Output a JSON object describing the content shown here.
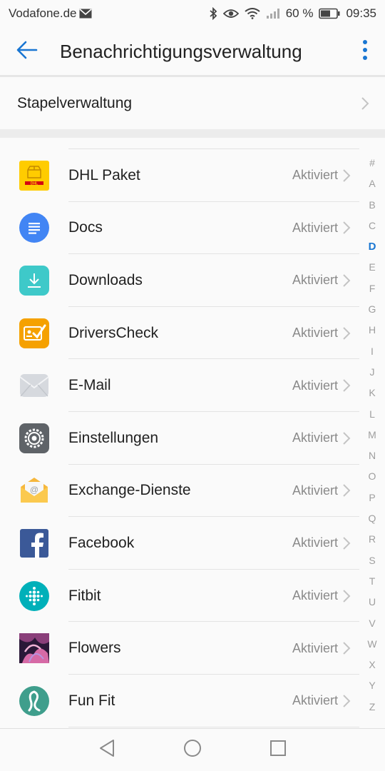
{
  "status_bar": {
    "carrier": "Vodafone.de",
    "battery_percent": "60 %",
    "time": "09:35",
    "icons": [
      "mail-icon",
      "bluetooth-icon",
      "eye-icon",
      "wifi-icon",
      "signal-icon",
      "battery-icon"
    ]
  },
  "header": {
    "title": "Benachrichtigungsverwaltung"
  },
  "stack": {
    "label": "Stapelverwaltung"
  },
  "apps": [
    {
      "name": "DHL Paket",
      "status": "Aktiviert",
      "icon": "dhl-icon"
    },
    {
      "name": "Docs",
      "status": "Aktiviert",
      "icon": "docs-icon"
    },
    {
      "name": "Downloads",
      "status": "Aktiviert",
      "icon": "downloads-icon"
    },
    {
      "name": "DriversCheck",
      "status": "Aktiviert",
      "icon": "driverscheck-icon"
    },
    {
      "name": "E-Mail",
      "status": "Aktiviert",
      "icon": "email-icon"
    },
    {
      "name": "Einstellungen",
      "status": "Aktiviert",
      "icon": "settings-icon"
    },
    {
      "name": "Exchange-Dienste",
      "status": "Aktiviert",
      "icon": "exchange-icon"
    },
    {
      "name": "Facebook",
      "status": "Aktiviert",
      "icon": "facebook-icon"
    },
    {
      "name": "Fitbit",
      "status": "Aktiviert",
      "icon": "fitbit-icon"
    },
    {
      "name": "Flowers",
      "status": "Aktiviert",
      "icon": "flowers-icon"
    },
    {
      "name": "Fun Fit",
      "status": "Aktiviert",
      "icon": "funfit-icon"
    }
  ],
  "index": {
    "letters": [
      "#",
      "A",
      "B",
      "C",
      "D",
      "E",
      "F",
      "G",
      "H",
      "I",
      "J",
      "K",
      "L",
      "M",
      "N",
      "O",
      "P",
      "Q",
      "R",
      "S",
      "T",
      "U",
      "V",
      "W",
      "X",
      "Y",
      "Z"
    ],
    "active": "D"
  },
  "colors": {
    "accent": "#1976d2",
    "secondary_text": "#8a8a8a",
    "divider": "#e3e3e3"
  }
}
